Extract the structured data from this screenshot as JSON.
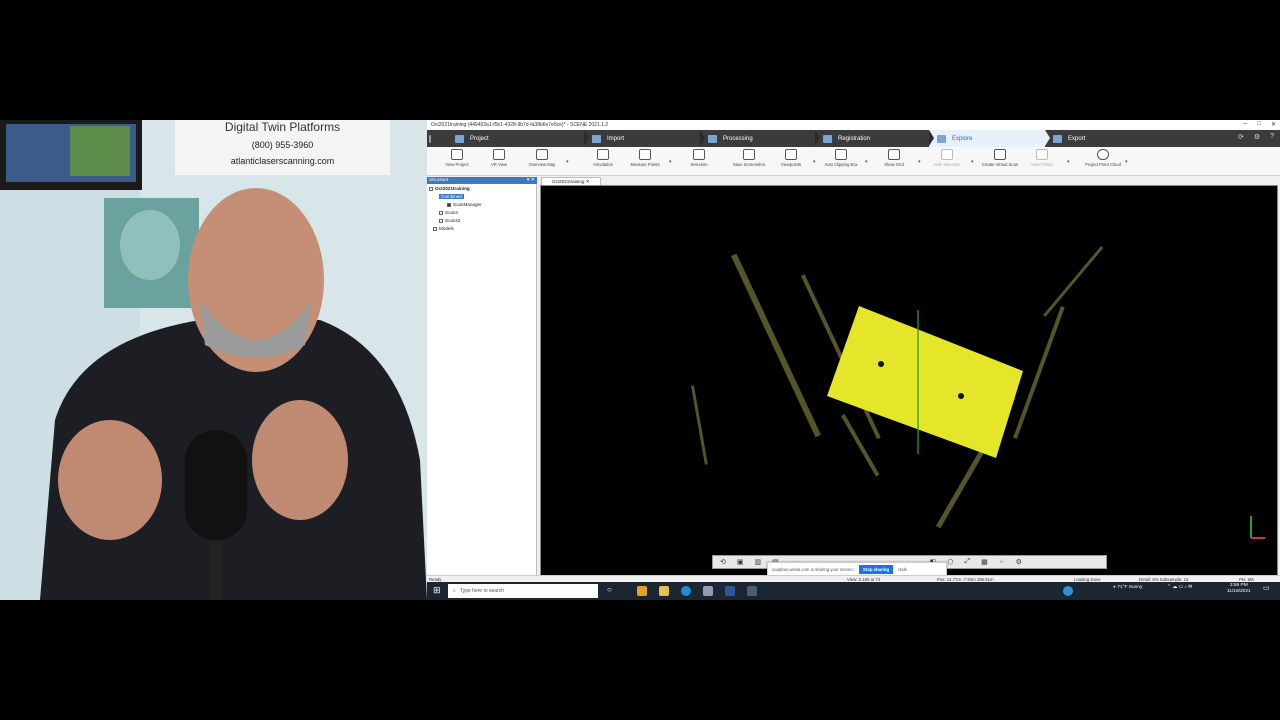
{
  "webcam": {
    "poster_title": "Digital Twin Platforms",
    "poster_phone": "(800) 955-3960",
    "poster_site": "atlanticlaserscanning.com"
  },
  "app": {
    "window_title": "Oct2021training (449402a1-f5b1-4328-9b7d-fa38b6e7e5ce)* - SCENE 2021.1.2",
    "window_controls": [
      "─",
      "□",
      "✕"
    ],
    "tabs": [
      "Project",
      "Import",
      "Processing",
      "Registration",
      "Explore",
      "Export"
    ],
    "active_tab": "Explore",
    "ribbon": {
      "view_project": "View Project",
      "vr_view": "VR View",
      "overview_map": "Overview Map",
      "annotation": "Annotation",
      "measure_points": "Measure Points",
      "selection": "Selection",
      "save_screenshot": "Save Screenshot",
      "viewpoints": "Viewpoints",
      "auto_clipping_box": "Auto Clipping Box",
      "show_grid": "Show Grid",
      "hide_selection": "Hide Selection",
      "create_virtual_scan": "Create Virtual Scan",
      "insert_point": "Insert Point",
      "project_point_cloud": "Project Point Cloud"
    },
    "structure_panel": {
      "title": "Structure",
      "controls": "▾ ✕",
      "root": "Oct2021training",
      "selected": "Combined",
      "items": [
        "ScanManager",
        "Scans",
        "Scans2",
        "Models"
      ]
    },
    "view_tab": "Oct2021training",
    "sharing_bar": {
      "message": "soapbox.wistia.com is sharing your screen.",
      "stop_button": "Stop sharing",
      "hide_link": "Hide"
    },
    "status": {
      "ready": "Ready",
      "view": "View: 0.160 at 74",
      "position": "Pos: 14.77m -7.92m 196.51m",
      "loading": "Loading Done",
      "detail": "Detail: 6%  Subsample: 15",
      "points": "Pts: 6M"
    }
  },
  "taskbar": {
    "search_placeholder": "Type here to search",
    "weather": "71°F  Sunny",
    "time": "3:56 PM",
    "date": "11/16/2021"
  },
  "colors": {
    "tab_bar": "#3b3b3b",
    "panel_header": "#3c78c4",
    "point_cloud": "#e5e52a",
    "taskbar": "#1c2633"
  }
}
